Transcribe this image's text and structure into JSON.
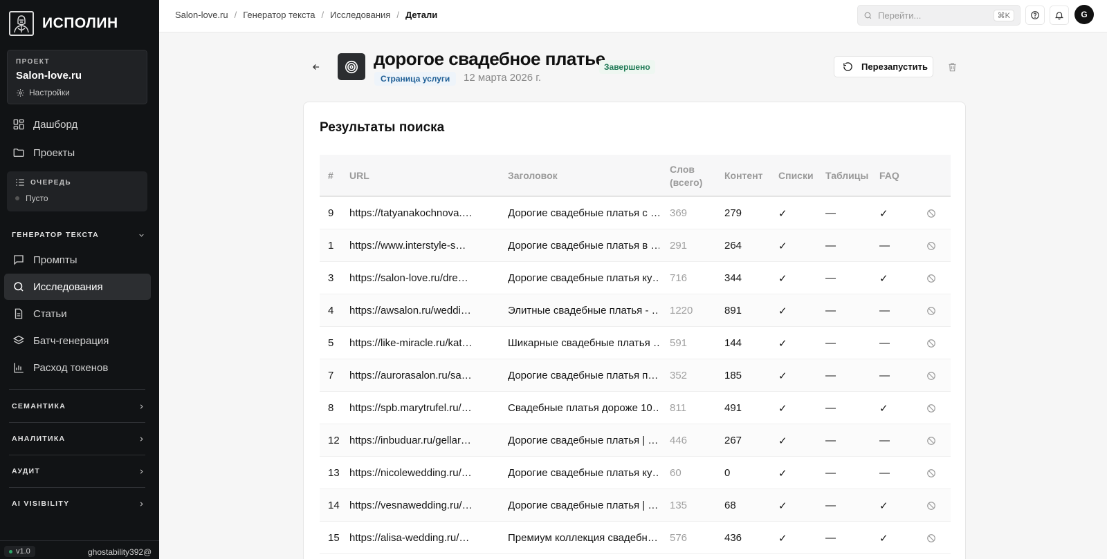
{
  "sidebar": {
    "brand": "ИСПОЛИН",
    "project": {
      "caption": "ПРОЕКТ",
      "name": "Salon-love.ru",
      "settings": "Настройки"
    },
    "nav_top": [
      {
        "label": "Дашборд",
        "icon": "dashboard-icon"
      },
      {
        "label": "Проекты",
        "icon": "folder-icon"
      }
    ],
    "queue": {
      "caption": "ОЧЕРЕДЬ",
      "status": "Пусто"
    },
    "generator_section": "ГЕНЕРАТОР ТЕКСТА",
    "generator_items": [
      {
        "label": "Промпты",
        "icon": "chat-icon"
      },
      {
        "label": "Исследования",
        "icon": "search-icon",
        "active": true
      },
      {
        "label": "Статьи",
        "icon": "document-icon"
      },
      {
        "label": "Батч-генерация",
        "icon": "layers-icon"
      },
      {
        "label": "Расход токенов",
        "icon": "bar-chart-icon"
      }
    ],
    "sections": [
      "СЕМАНТИКА",
      "АНАЛИТИКА",
      "АУДИТ",
      "AI VISIBILITY"
    ],
    "version": "v1.0",
    "user": "ghostability392@"
  },
  "topbar": {
    "breadcrumb": [
      "Salon-love.ru",
      "Генератор текста",
      "Исследования",
      "Детали"
    ],
    "search_placeholder": "Перейти...",
    "search_shortcut": "⌘K",
    "avatar_letter": "G"
  },
  "header": {
    "title": "дорогое свадебное платье",
    "status": "Завершено",
    "type": "Страница услуги",
    "date": "12 марта 2026 г.",
    "restart_label": "Перезапустить"
  },
  "results": {
    "title": "Результаты поиска",
    "columns": {
      "num": "#",
      "url": "URL",
      "title": "Заголовок",
      "words": "Слов (всего)",
      "content": "Контент",
      "lists": "Списки",
      "tables": "Таблицы",
      "faq": "FAQ"
    },
    "rows": [
      {
        "num": "9",
        "url": "https://tatyanakochnova.…",
        "title": "Дорогие свадебные платья с …",
        "words": "369",
        "content": "279",
        "lists": "✓",
        "tables": "—",
        "faq": "✓"
      },
      {
        "num": "1",
        "url": "https://www.interstyle-s…",
        "title": "Дорогие свадебные платья в …",
        "words": "291",
        "content": "264",
        "lists": "✓",
        "tables": "—",
        "faq": "—"
      },
      {
        "num": "3",
        "url": "https://salon-love.ru/dre…",
        "title": "Дорогие свадебные платья ку…",
        "words": "716",
        "content": "344",
        "lists": "✓",
        "tables": "—",
        "faq": "✓"
      },
      {
        "num": "4",
        "url": "https://awsalon.ru/weddi…",
        "title": "Элитные свадебные платья - …",
        "words": "1220",
        "content": "891",
        "lists": "✓",
        "tables": "—",
        "faq": "—"
      },
      {
        "num": "5",
        "url": "https://like-miracle.ru/kat…",
        "title": "Шикарные свадебные платья …",
        "words": "591",
        "content": "144",
        "lists": "✓",
        "tables": "—",
        "faq": "—"
      },
      {
        "num": "7",
        "url": "https://aurorasalon.ru/sa…",
        "title": "Дорогие свадебные платья п…",
        "words": "352",
        "content": "185",
        "lists": "✓",
        "tables": "—",
        "faq": "—"
      },
      {
        "num": "8",
        "url": "https://spb.marytrufel.ru/…",
        "title": "Свадебные платья дороже 10…",
        "words": "811",
        "content": "491",
        "lists": "✓",
        "tables": "—",
        "faq": "✓"
      },
      {
        "num": "12",
        "url": "https://inbuduar.ru/gellar…",
        "title": "Дорогие свадебные платья | …",
        "words": "446",
        "content": "267",
        "lists": "✓",
        "tables": "—",
        "faq": "—"
      },
      {
        "num": "13",
        "url": "https://nicolewedding.ru/…",
        "title": "Дорогие свадебные платья ку…",
        "words": "60",
        "content": "0",
        "lists": "✓",
        "tables": "—",
        "faq": "—"
      },
      {
        "num": "14",
        "url": "https://vesnawedding.ru/…",
        "title": "Дорогие свадебные платья | …",
        "words": "135",
        "content": "68",
        "lists": "✓",
        "tables": "—",
        "faq": "✓"
      },
      {
        "num": "15",
        "url": "https://alisa-wedding.ru/…",
        "title": "Премиум коллекция свадебн…",
        "words": "576",
        "content": "436",
        "lists": "✓",
        "tables": "—",
        "faq": "✓"
      }
    ]
  },
  "colors": {
    "sidebar_bg": "#111315",
    "status_green": "#1e7a55",
    "type_blue": "#1f5f96"
  }
}
